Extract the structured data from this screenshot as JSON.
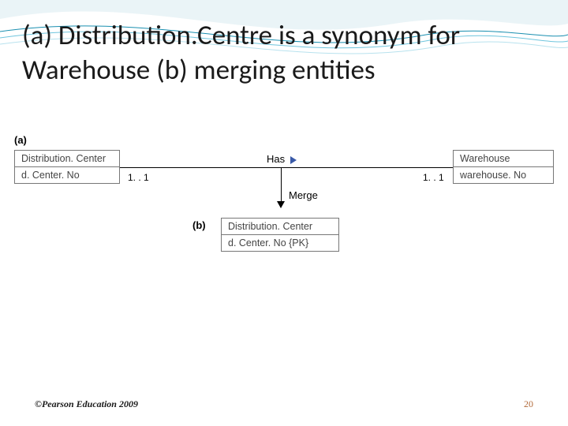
{
  "title": "(a) Distribution.Centre is a synonym for Warehouse (b) merging entities",
  "sectionA": "(a)",
  "sectionB": "(b)",
  "entityA_left_name": "Distribution. Center",
  "entityA_left_attr": "d. Center. No",
  "entityA_right_name": "Warehouse",
  "entityA_right_attr": "warehouse. No",
  "mult_left": "1. . 1",
  "mult_right": "1. . 1",
  "rel_label": "Has",
  "merge_label": "Merge",
  "entityB_name": "Distribution. Center",
  "entityB_attr": "d. Center. No {PK}",
  "footer_left": "©Pearson Education 2009",
  "page_number": "20"
}
